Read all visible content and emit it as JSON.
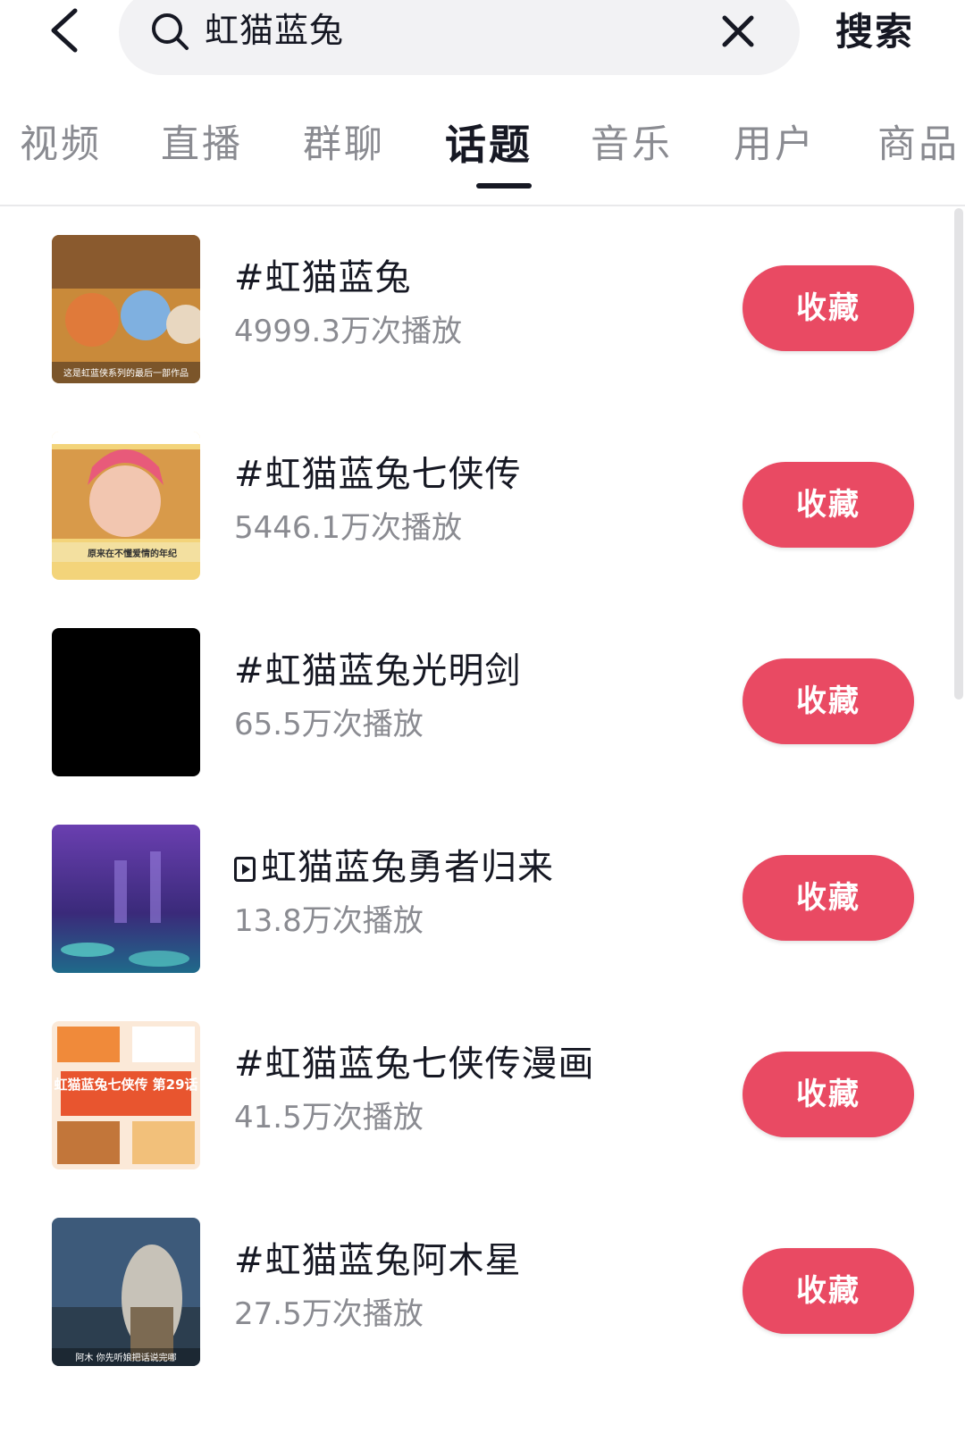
{
  "header": {
    "back_icon": "chevron-left-icon",
    "search": {
      "icon": "search-icon",
      "query": "虹猫蓝兔",
      "clear_icon": "close-icon"
    },
    "submit_label": "搜索"
  },
  "tabs": [
    {
      "label": "视频",
      "active": false
    },
    {
      "label": "直播",
      "active": false
    },
    {
      "label": "群聊",
      "active": false
    },
    {
      "label": "话题",
      "active": true
    },
    {
      "label": "音乐",
      "active": false
    },
    {
      "label": "用户",
      "active": false
    },
    {
      "label": "商品",
      "active": false
    }
  ],
  "topics": [
    {
      "title": "#虹猫蓝兔",
      "plays": "4999.3万次播放",
      "button": "收藏",
      "thumb_caption": "这是虹蓝侠系列的最后一部作品",
      "thumb_style": "cartoon-characters"
    },
    {
      "title": "#虹猫蓝兔七侠传",
      "plays": "5446.1万次播放",
      "button": "收藏",
      "thumb_caption": "原来在不懂爱情的年纪",
      "thumb_style": "pink-hair-girl"
    },
    {
      "title": "#虹猫蓝兔光明剑",
      "plays": "65.5万次播放",
      "button": "收藏",
      "thumb_caption": "",
      "thumb_style": "black"
    },
    {
      "title": "虹猫蓝兔勇者归来",
      "prefix_icon": "video-icon",
      "plays": "13.8万次播放",
      "button": "收藏",
      "thumb_caption": "",
      "thumb_style": "purple-cave"
    },
    {
      "title": "#虹猫蓝兔七侠传漫画",
      "plays": "41.5万次播放",
      "button": "收藏",
      "thumb_caption": "虹猫蓝兔七侠传 第29话",
      "thumb_style": "comic-page"
    },
    {
      "title": "#虹猫蓝兔阿木星",
      "plays": "27.5万次播放",
      "button": "收藏",
      "thumb_caption": "阿木 你先听娘把话说完哪",
      "thumb_style": "night-forest"
    }
  ],
  "colors": {
    "accent": "#e94a63",
    "text_primary": "#161823",
    "text_secondary": "#8a8b91",
    "search_bg": "#f2f2f4"
  }
}
